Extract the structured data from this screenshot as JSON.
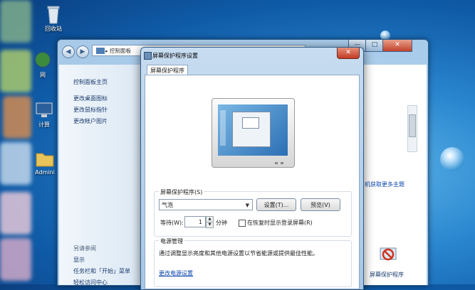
{
  "desktop": {
    "icons": [
      {
        "label": "回收站",
        "name": "recycle-bin-icon"
      },
      {
        "label": "网",
        "name": "network-icon"
      },
      {
        "label": "计算",
        "name": "computer-icon"
      },
      {
        "label": "Admini",
        "name": "user-folder-icon"
      }
    ]
  },
  "control_panel": {
    "address": "控制面板",
    "sidebar": {
      "home": "控制面板主页",
      "links": [
        "更改桌面图标",
        "更改鼠标指针",
        "更改帐户图片"
      ],
      "see_also": "另请参阅",
      "see_also_links": [
        "显示",
        "任务栏和「开始」菜单",
        "轻松访问中心"
      ]
    },
    "get_more_themes": "机获取更多主题",
    "screensaver_tile_label": "屏幕保护程序",
    "window_buttons": {
      "minimize": "—",
      "maximize": "□",
      "close": "✕"
    },
    "help": "?"
  },
  "dialog": {
    "title": "屏幕保护程序设置",
    "close": "✕",
    "tab": "屏幕保护程序",
    "screensaver_group": {
      "legend": "屏幕保护程序(S)",
      "selected": "气泡",
      "settings_button": "设置(T)...",
      "preview_button": "预览(V)",
      "wait_label": "等待(W):",
      "wait_value": "1",
      "wait_unit": "分钟",
      "resume_checkbox_label": "在恢复时显示登录屏幕(R)",
      "resume_checked": false
    },
    "power_group": {
      "legend": "电源管理",
      "description": "通过调整显示亮度和其他电源设置以节省能源或提供最佳性能。",
      "link": "更改电源设置"
    }
  }
}
